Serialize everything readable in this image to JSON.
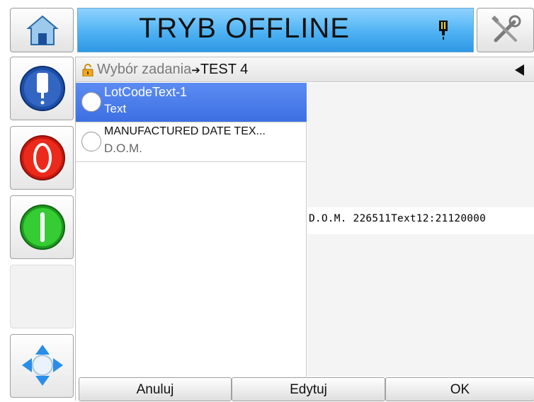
{
  "header": {
    "title": "TRYB OFFLINE",
    "home_icon": "home-icon",
    "ink_icon": "printhead-icon",
    "tools_icon": "tools-icon"
  },
  "rail": {
    "buttons": [
      "printhead-status-icon",
      "stop-icon",
      "start-icon",
      "",
      "navigation-icon"
    ]
  },
  "breadcrumb": {
    "root": "Wybór zadania",
    "separator": "➔",
    "current": "TEST 4"
  },
  "list": {
    "items": [
      {
        "title": "LotCodeText-1",
        "subtitle": "Text",
        "selected": true
      },
      {
        "title": "MANUFACTURED DATE TEX...",
        "subtitle": "D.O.M.",
        "selected": false
      }
    ]
  },
  "preview": {
    "text": "D.O.M. 226511Text12:21120000"
  },
  "footer": {
    "cancel": "Anuluj",
    "edit": "Edytuj",
    "ok": "OK"
  },
  "colors": {
    "status_bar": "#4eb2f3",
    "selection": "#4a7cec",
    "stop": "#e8261a",
    "start": "#29c02a",
    "rail_icon": "#1b4fa8"
  }
}
